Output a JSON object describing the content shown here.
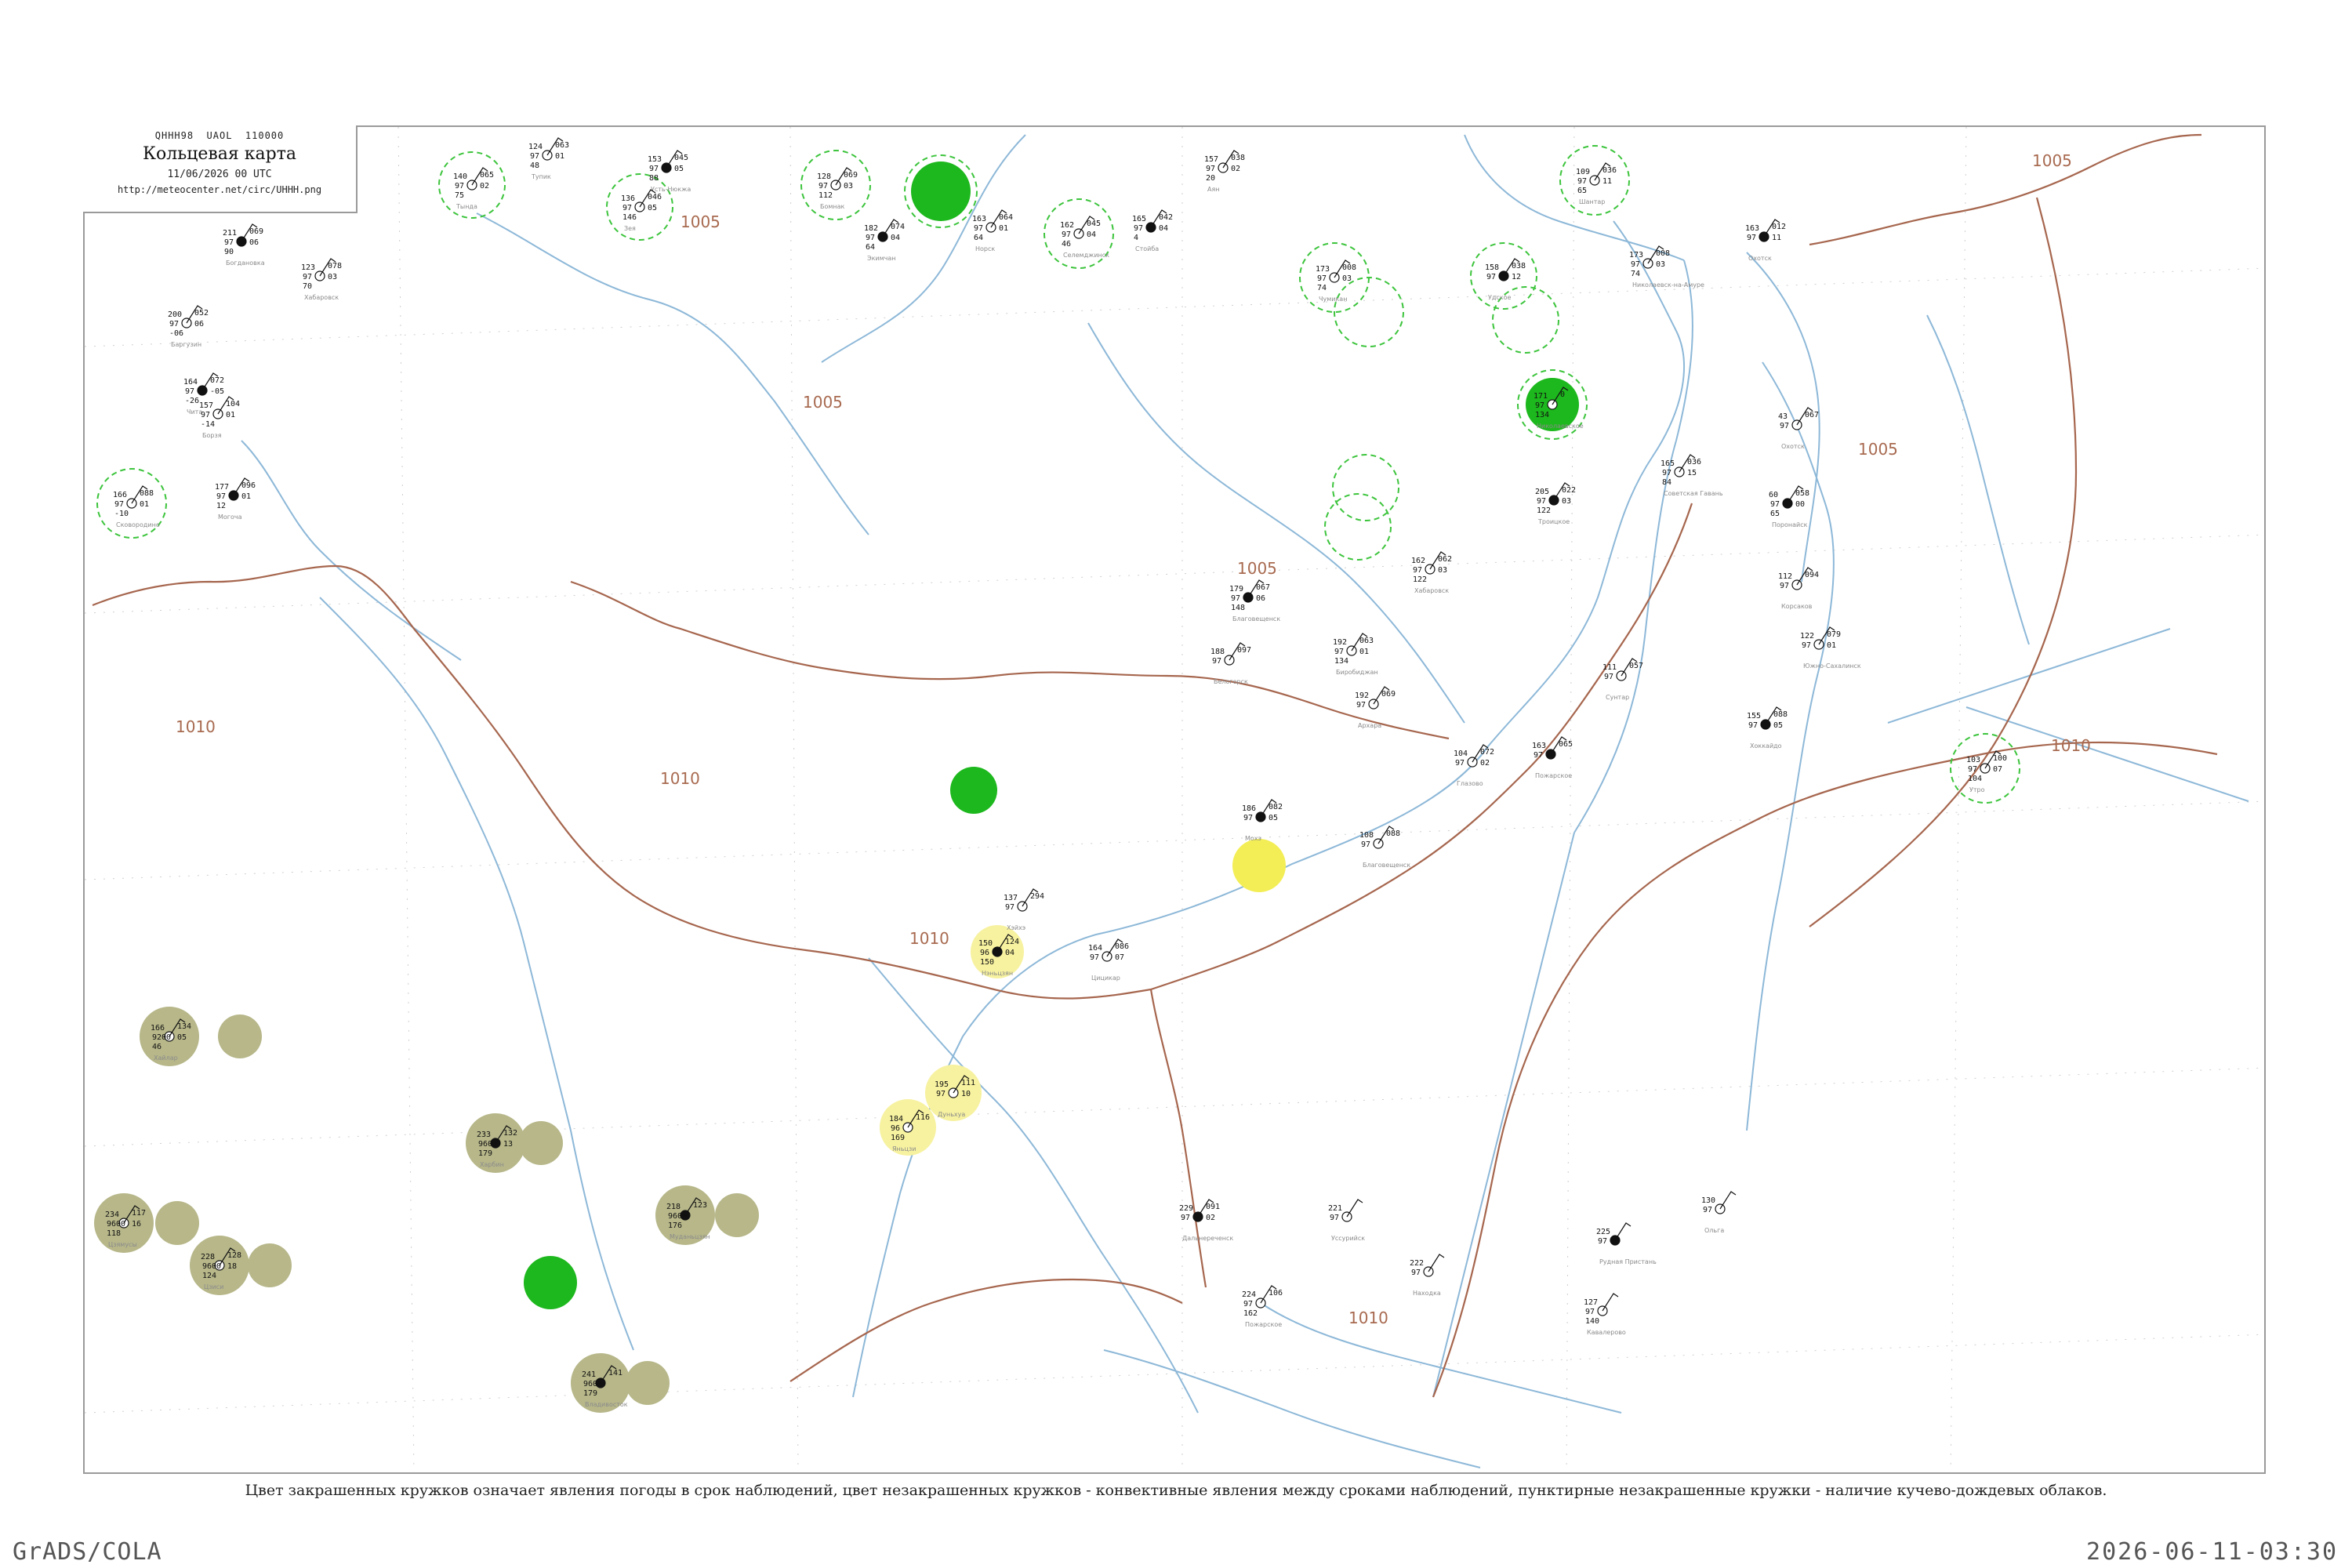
{
  "header": {
    "code": "QHHH98  UAOL  110000",
    "title": "Кольцевая карта",
    "datetime": "11/06/2026 00 UTC",
    "url": "http://meteocenter.net/circ/UHHH.png"
  },
  "caption": "Цвет закрашенных кружков означает явления погоды в срок наблюдений, цвет незакрашенных кружков - конвективные явления между сроками наблюдений, пунктирные незакрашенные кружки - наличие кучево-дождевых облаков.",
  "footer": {
    "left": "GrADS/COLA",
    "right": "2026-06-11-03:30"
  },
  "colors": {
    "isobar": "#b5806a",
    "river": "#8db8d8",
    "border": "#9a9a9a",
    "rain_green": "#1db81d",
    "fog_yellow": "#f6ef5a",
    "haze_olive": "#b7b78a",
    "cb_dashed": "#3cc43c"
  },
  "isobar_labels": [
    "1005",
    "1005",
    "1005",
    "1005",
    "1010",
    "1010",
    "1010",
    "1010",
    "1010",
    "1005"
  ],
  "stations": [
    {
      "id": "s1",
      "t": "211",
      "p": "069",
      "d": "97",
      "v": "06",
      "w": "90",
      "name": "Богдановка"
    },
    {
      "id": "s2",
      "t": "123",
      "p": "078",
      "d": "97",
      "v": "03",
      "w": "70",
      "name": "Хабаровск"
    },
    {
      "id": "s3",
      "t": "200",
      "p": "052",
      "d": "97",
      "v": "06",
      "w": "-06",
      "name": "Баргузин"
    },
    {
      "id": "s4",
      "t": "164",
      "p": "072",
      "d": "97",
      "v": "-05",
      "w": "-26",
      "name": "Чита"
    },
    {
      "id": "s5",
      "t": "157",
      "p": "104",
      "d": "97",
      "v": "01",
      "w": "-14",
      "name": "Борзя"
    },
    {
      "id": "s6",
      "t": "166",
      "p": "088",
      "d": "97",
      "v": "01",
      "w": "-10",
      "name": "Сковородино"
    },
    {
      "id": "s7",
      "t": "177",
      "p": "096",
      "d": "97",
      "v": "01",
      "w": "12",
      "name": "Могоча"
    },
    {
      "id": "s8",
      "t": "140",
      "p": "065",
      "d": "97",
      "v": "02",
      "w": "75",
      "name": "Тында"
    },
    {
      "id": "s9",
      "t": "124",
      "p": "063",
      "d": "97",
      "v": "01",
      "w": "48",
      "name": "Тупик"
    },
    {
      "id": "s10",
      "t": "153",
      "p": "045",
      "d": "97",
      "v": "05",
      "w": "88",
      "name": "Усть-Нюкжа"
    },
    {
      "id": "s11",
      "t": "136",
      "p": "046",
      "d": "97",
      "v": "05",
      "w": "146",
      "name": "Зея"
    },
    {
      "id": "s12",
      "t": "128",
      "p": "069",
      "d": "97",
      "v": "03",
      "w": "112",
      "name": "Бомнак"
    },
    {
      "id": "s13",
      "t": "182",
      "p": "074",
      "d": "97",
      "v": "04",
      "w": "64",
      "name": "Экимчан"
    },
    {
      "id": "s14",
      "t": "163",
      "p": "064",
      "d": "97",
      "v": "01",
      "w": "64",
      "name": "Норск"
    },
    {
      "id": "s15",
      "t": "162",
      "p": "045",
      "d": "97",
      "v": "04",
      "w": "46",
      "name": "Селемджинск"
    },
    {
      "id": "s16",
      "t": "165",
      "p": "042",
      "d": "97",
      "v": "04",
      "w": "4",
      "name": "Стойба"
    },
    {
      "id": "s17",
      "t": "157",
      "p": "038",
      "d": "97",
      "v": "02",
      "w": "20",
      "name": "Аян"
    },
    {
      "id": "s18",
      "t": "109",
      "p": "036",
      "d": "97",
      "v": "11",
      "w": "65",
      "name": "Шантар"
    },
    {
      "id": "s19",
      "t": "163",
      "p": "012",
      "d": "97",
      "v": "11",
      "w": "",
      "name": "Охотск"
    },
    {
      "id": "s20",
      "t": "173",
      "p": "008",
      "d": "97",
      "v": "03",
      "w": "74",
      "name": "Николаевск-на-Амуре"
    },
    {
      "id": "s21",
      "t": "173",
      "p": "008",
      "d": "97",
      "v": "03",
      "w": "74",
      "name": "Чумикан"
    },
    {
      "id": "s22",
      "t": "158",
      "p": "038",
      "d": "97",
      "v": "12",
      "w": "",
      "name": "Удское"
    },
    {
      "id": "s23",
      "t": "171",
      "p": "0",
      "d": "97",
      "v": "",
      "w": "134",
      "name": "Николаевское"
    },
    {
      "id": "s24",
      "t": "43",
      "p": "067",
      "d": "97",
      "v": "",
      "w": "",
      "name": "Охотск"
    },
    {
      "id": "s25",
      "t": "60",
      "p": "058",
      "d": "97",
      "v": "00",
      "w": "65",
      "name": "Поронайск"
    },
    {
      "id": "s26",
      "t": "112",
      "p": "094",
      "d": "97",
      "v": "",
      "w": "",
      "name": "Корсаков"
    },
    {
      "id": "s27",
      "t": "122",
      "p": "079",
      "d": "97",
      "v": "01",
      "w": "",
      "name": "Южно-Сахалинск"
    },
    {
      "id": "s28",
      "t": "155",
      "p": "088",
      "d": "97",
      "v": "05",
      "w": "",
      "name": "Хоккайдо"
    },
    {
      "id": "s29",
      "t": "103",
      "p": "100",
      "d": "97",
      "v": "07",
      "w": "104",
      "name": "Утро"
    },
    {
      "id": "s30",
      "t": "165",
      "p": "036",
      "d": "97",
      "v": "15",
      "w": "84",
      "name": "Советская Гавань"
    },
    {
      "id": "s31",
      "t": "205",
      "p": "022",
      "d": "97",
      "v": "03",
      "w": "122",
      "name": "Троицкое"
    },
    {
      "id": "s32",
      "t": "162",
      "p": "062",
      "d": "97",
      "v": "03",
      "w": "122",
      "name": "Хабаровск"
    },
    {
      "id": "s33",
      "t": "111",
      "p": "057",
      "d": "97",
      "v": "",
      "w": "",
      "name": "Сунтар"
    },
    {
      "id": "s34",
      "t": "163",
      "p": "065",
      "d": "97",
      "v": "",
      "w": "",
      "name": "Пожарское"
    },
    {
      "id": "s35",
      "t": "104",
      "p": "072",
      "d": "97",
      "v": "02",
      "w": "",
      "name": "Глазово"
    },
    {
      "id": "s36",
      "t": "192",
      "p": "063",
      "d": "97",
      "v": "01",
      "w": "134",
      "name": "Биробиджан"
    },
    {
      "id": "s37",
      "t": "179",
      "p": "067",
      "d": "97",
      "v": "06",
      "w": "148",
      "name": "Благовещенск"
    },
    {
      "id": "s38",
      "t": "188",
      "p": "097",
      "d": "97",
      "v": "",
      "w": "",
      "name": "Белогорск"
    },
    {
      "id": "s39",
      "t": "192",
      "p": "069",
      "d": "97",
      "v": "",
      "w": "",
      "name": "Архара"
    },
    {
      "id": "s40",
      "t": "186",
      "p": "082",
      "d": "97",
      "v": "05",
      "w": "",
      "name": "Мохэ"
    },
    {
      "id": "s41",
      "t": "108",
      "p": "088",
      "d": "97",
      "v": "",
      "w": "",
      "name": "Благовещенск"
    },
    {
      "id": "s42",
      "t": "137",
      "p": "294",
      "d": "97",
      "v": "",
      "w": "",
      "name": "Хэйхэ"
    },
    {
      "id": "s43",
      "t": "150",
      "p": "124",
      "d": "96",
      "v": "04",
      "w": "150",
      "name": "Нэньцзян"
    },
    {
      "id": "s44",
      "t": "164",
      "p": "086",
      "d": "97",
      "v": "07",
      "w": "",
      "name": "Цицикар"
    },
    {
      "id": "s45",
      "t": "166",
      "p": "134",
      "d": "9200",
      "v": "05",
      "w": "46",
      "name": "Хайлар"
    },
    {
      "id": "s46",
      "t": "233",
      "p": "132",
      "d": "9600",
      "v": "13",
      "w": "179",
      "name": "Харбин"
    },
    {
      "id": "s47",
      "t": "234",
      "p": "117",
      "d": "9600",
      "v": "16",
      "w": "118",
      "name": "Цзямусы"
    },
    {
      "id": "s48",
      "t": "228",
      "p": "128",
      "d": "9600",
      "v": "18",
      "w": "124",
      "name": "Цзиси"
    },
    {
      "id": "s49",
      "t": "218",
      "p": "123",
      "d": "9600",
      "v": "",
      "w": "176",
      "name": "Муданьцзян"
    },
    {
      "id": "s50",
      "t": "195",
      "p": "111",
      "d": "97",
      "v": "10",
      "w": "",
      "name": "Дуньхуа"
    },
    {
      "id": "s51",
      "t": "184",
      "p": "116",
      "d": "96",
      "v": "",
      "w": "169",
      "name": "Яньцзи"
    },
    {
      "id": "s52",
      "t": "241",
      "p": "141",
      "d": "9600",
      "v": "",
      "w": "179",
      "name": "Владивосток"
    },
    {
      "id": "s53",
      "t": "221",
      "p": "",
      "d": "97",
      "v": "",
      "w": "",
      "name": "Уссурийск"
    },
    {
      "id": "s54",
      "t": "222",
      "p": "",
      "d": "97",
      "v": "",
      "w": "",
      "name": "Находка"
    },
    {
      "id": "s55",
      "t": "229",
      "p": "091",
      "d": "97",
      "v": "02",
      "w": "",
      "name": "Дальнереченск"
    },
    {
      "id": "s56",
      "t": "224",
      "p": "106",
      "d": "97",
      "v": "",
      "w": "162",
      "name": "Пожарское"
    },
    {
      "id": "s57",
      "t": "127",
      "p": "",
      "d": "97",
      "v": "",
      "w": "140",
      "name": "Кавалерово"
    },
    {
      "id": "s58",
      "t": "225",
      "p": "",
      "d": "97",
      "v": "",
      "w": "",
      "name": "Рудная Пристань"
    },
    {
      "id": "s59",
      "t": "130",
      "p": "",
      "d": "97",
      "v": "",
      "w": "",
      "name": "Ольга"
    }
  ]
}
